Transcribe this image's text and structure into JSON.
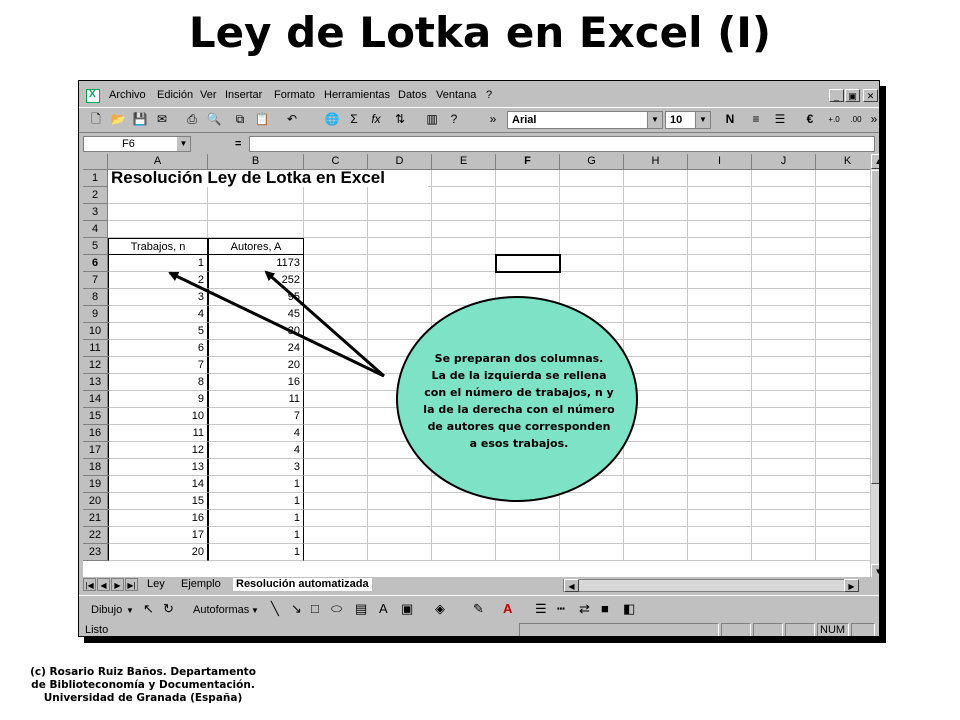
{
  "slide": {
    "title": "Ley de Lotka en Excel (I)",
    "credit_lines": [
      "(c) Rosario Ruiz Baños. Departamento",
      "de Biblioteconomía y Documentación.",
      "Universidad de Granada (España)"
    ]
  },
  "excel": {
    "menu": [
      "Archivo",
      "Edición",
      "Ver",
      "Insertar",
      "Formato",
      "Herramientas",
      "Datos",
      "Ventana",
      "?"
    ],
    "window_buttons": [
      "_",
      "▣",
      "✕"
    ],
    "toolbar": {
      "font": "Arial",
      "font_size": "10",
      "icons": [
        "new-icon",
        "open-icon",
        "save-icon",
        "mail-icon",
        "print-icon",
        "preview-icon",
        "copy-icon",
        "paste-icon",
        "undo-icon",
        "hyperlink-icon",
        "autosum-icon",
        "function-icon",
        "sort-icon",
        "chart-icon",
        "help-icon",
        "bold-icon",
        "align-center-icon",
        "align-right-icon",
        "euro-icon",
        "increase-decimal-icon",
        "decrease-decimal-icon"
      ]
    },
    "formula_bar": {
      "cell_ref": "F6",
      "equals": "=",
      "content": ""
    },
    "columns": [
      "A",
      "B",
      "C",
      "D",
      "E",
      "F",
      "G",
      "H",
      "I",
      "J",
      "K"
    ],
    "rows": [
      "1",
      "2",
      "3",
      "4",
      "5",
      "6",
      "7",
      "8",
      "9",
      "10",
      "11",
      "12",
      "13",
      "14",
      "15",
      "16",
      "17",
      "18",
      "19",
      "20",
      "21",
      "22",
      "23"
    ],
    "sheet_title": "Resolución Ley de Lotka en Excel",
    "table": {
      "headers": [
        "Trabajos, n",
        "Autores, A"
      ],
      "rows": [
        [
          "1",
          "1173"
        ],
        [
          "2",
          "252"
        ],
        [
          "3",
          "95"
        ],
        [
          "4",
          "45"
        ],
        [
          "5",
          "30"
        ],
        [
          "6",
          "24"
        ],
        [
          "7",
          "20"
        ],
        [
          "8",
          "16"
        ],
        [
          "9",
          "11"
        ],
        [
          "10",
          "7"
        ],
        [
          "11",
          "4"
        ],
        [
          "12",
          "4"
        ],
        [
          "13",
          "3"
        ],
        [
          "14",
          "1"
        ],
        [
          "15",
          "1"
        ],
        [
          "16",
          "1"
        ],
        [
          "17",
          "1"
        ],
        [
          "20",
          "1"
        ]
      ]
    },
    "active_cell": "F6",
    "sheet_tabs": [
      "Ley",
      "Ejemplo",
      "Resolución automatizada"
    ],
    "active_tab": "Resolución automatizada",
    "drawing_toolbar": {
      "draw": "Dibujo",
      "autoshapes": "Autoformas"
    },
    "status": {
      "text": "Listo",
      "num": "NUM"
    }
  },
  "callout": {
    "lines": [
      "Se preparan dos columnas.",
      "La de la izquierda se rellena",
      "con el número de trabajos, n y",
      "la de la derecha con el número",
      "de autores que corresponden",
      "a esos trabajos."
    ],
    "fill": "#7ee3c6"
  }
}
